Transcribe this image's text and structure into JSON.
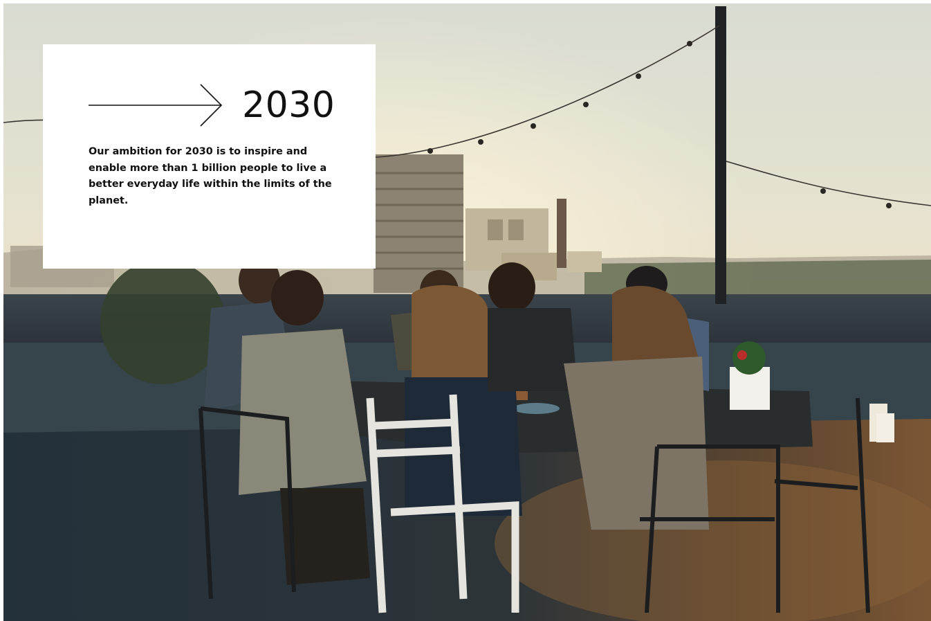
{
  "card": {
    "year": "2030",
    "text": "Our ambition for 2030 is to inspire and enable more than 1 billion people to live a better everyday life within the limits of the planet."
  },
  "icons": {
    "arrow": "arrow-right-icon"
  },
  "colors": {
    "card_background": "#ffffff",
    "text": "#111111"
  }
}
